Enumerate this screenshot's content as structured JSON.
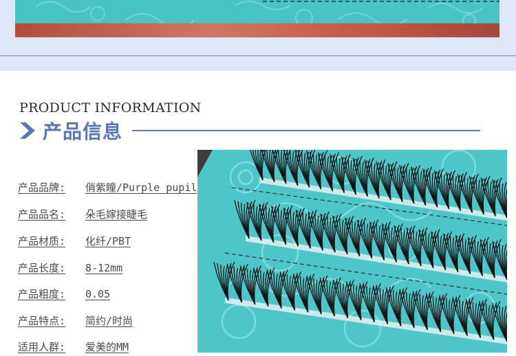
{
  "section": {
    "title_en": "PRODUCT INFORMATION",
    "title_cn": "产品信息",
    "accent_color": "#5a76b6"
  },
  "specs": [
    {
      "label": "产品品牌:",
      "value": "俏紫瞳/Purple pupil"
    },
    {
      "label": "产品品名:",
      "value": "朵毛嫁接睫毛"
    },
    {
      "label": "产品材质:",
      "value": "化纤/PBT"
    },
    {
      "label": "产品长度:",
      "value": "8-12mm"
    },
    {
      "label": "产品粗度:",
      "value": "0.05"
    },
    {
      "label": "产品特点:",
      "value": "简约/时尚"
    },
    {
      "label": "适用人群:",
      "value": "爱美的MM"
    }
  ],
  "images": {
    "top_photo": "lash-tray-top-photo",
    "product_photo": "eyelash-cluster-tray-photo"
  },
  "colors": {
    "band": "#dfe7f7",
    "teal": "#48c3c6",
    "text": "#4a4a4a"
  }
}
